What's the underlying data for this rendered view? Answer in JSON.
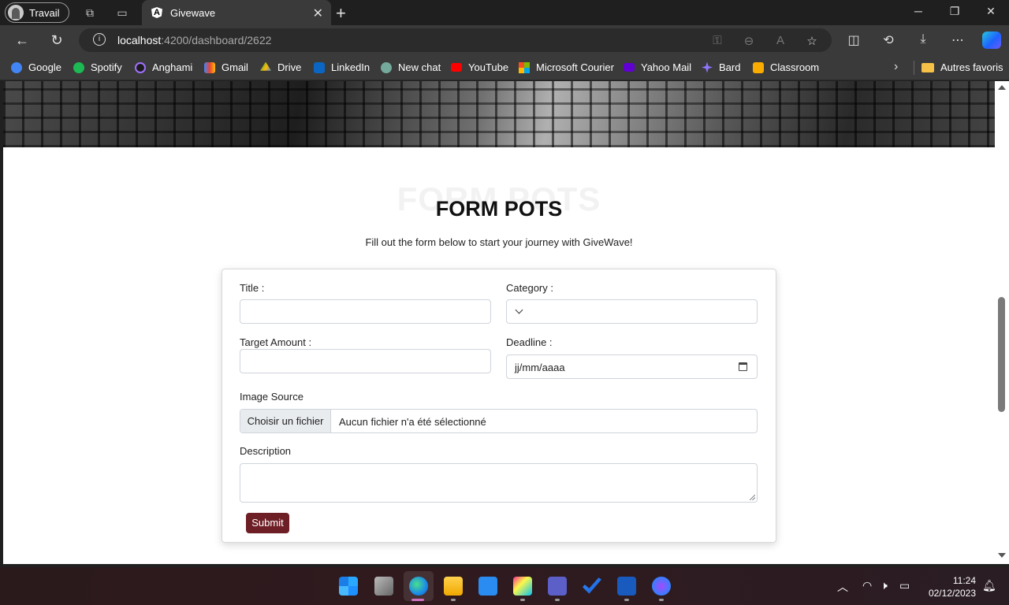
{
  "browser": {
    "profile_label": "Travail",
    "tab_title": "Givewave",
    "url_host": "localhost",
    "url_path": ":4200/dashboard/2622"
  },
  "bookmarks": [
    {
      "label": "Google",
      "icon": "google-icon",
      "color": "#4285f4"
    },
    {
      "label": "Spotify",
      "icon": "spotify-icon",
      "color": "#1db954"
    },
    {
      "label": "Anghami",
      "icon": "anghami-icon",
      "color": "#7a3cff"
    },
    {
      "label": "Gmail",
      "icon": "gmail-icon",
      "color": "#ea4335"
    },
    {
      "label": "Drive",
      "icon": "drive-icon",
      "color": "#fbbc04"
    },
    {
      "label": "LinkedIn",
      "icon": "linkedin-icon",
      "color": "#0a66c2"
    },
    {
      "label": "New chat",
      "icon": "chatgpt-icon",
      "color": "#74aa9c"
    },
    {
      "label": "YouTube",
      "icon": "youtube-icon",
      "color": "#ff0000"
    },
    {
      "label": "Microsoft Courier",
      "icon": "microsoft-icon",
      "color": "#f25022"
    },
    {
      "label": "Yahoo Mail",
      "icon": "yahoo-icon",
      "color": "#6001d2"
    },
    {
      "label": "Bard",
      "icon": "bard-icon",
      "color": "#8e75ff"
    },
    {
      "label": "Classroom",
      "icon": "classroom-icon",
      "color": "#f9ab00"
    }
  ],
  "other_favorites_label": "Autres favoris",
  "page": {
    "ghost_title": "FORM POTS",
    "title": "FORM POTS",
    "subtitle": "Fill out the form below to start your journey with GiveWave!",
    "form": {
      "title_label": "Title :",
      "title_value": "",
      "category_label": "Category :",
      "category_value": "",
      "target_label": "Target Amount :",
      "target_value": "",
      "deadline_label": "Deadline :",
      "deadline_placeholder": "jj/mm/aaaa",
      "image_label": "Image Source",
      "file_button": "Choisir un fichier",
      "file_status": "Aucun fichier n'a été sélectionné",
      "description_label": "Description",
      "description_value": "",
      "submit_label": "Submit"
    }
  },
  "taskbar": {
    "time": "11:24",
    "date": "02/12/2023"
  },
  "colors": {
    "submit": "#6e1f25",
    "browser_chrome": "#3a3a3a",
    "titlebar": "#1f1f1f"
  }
}
